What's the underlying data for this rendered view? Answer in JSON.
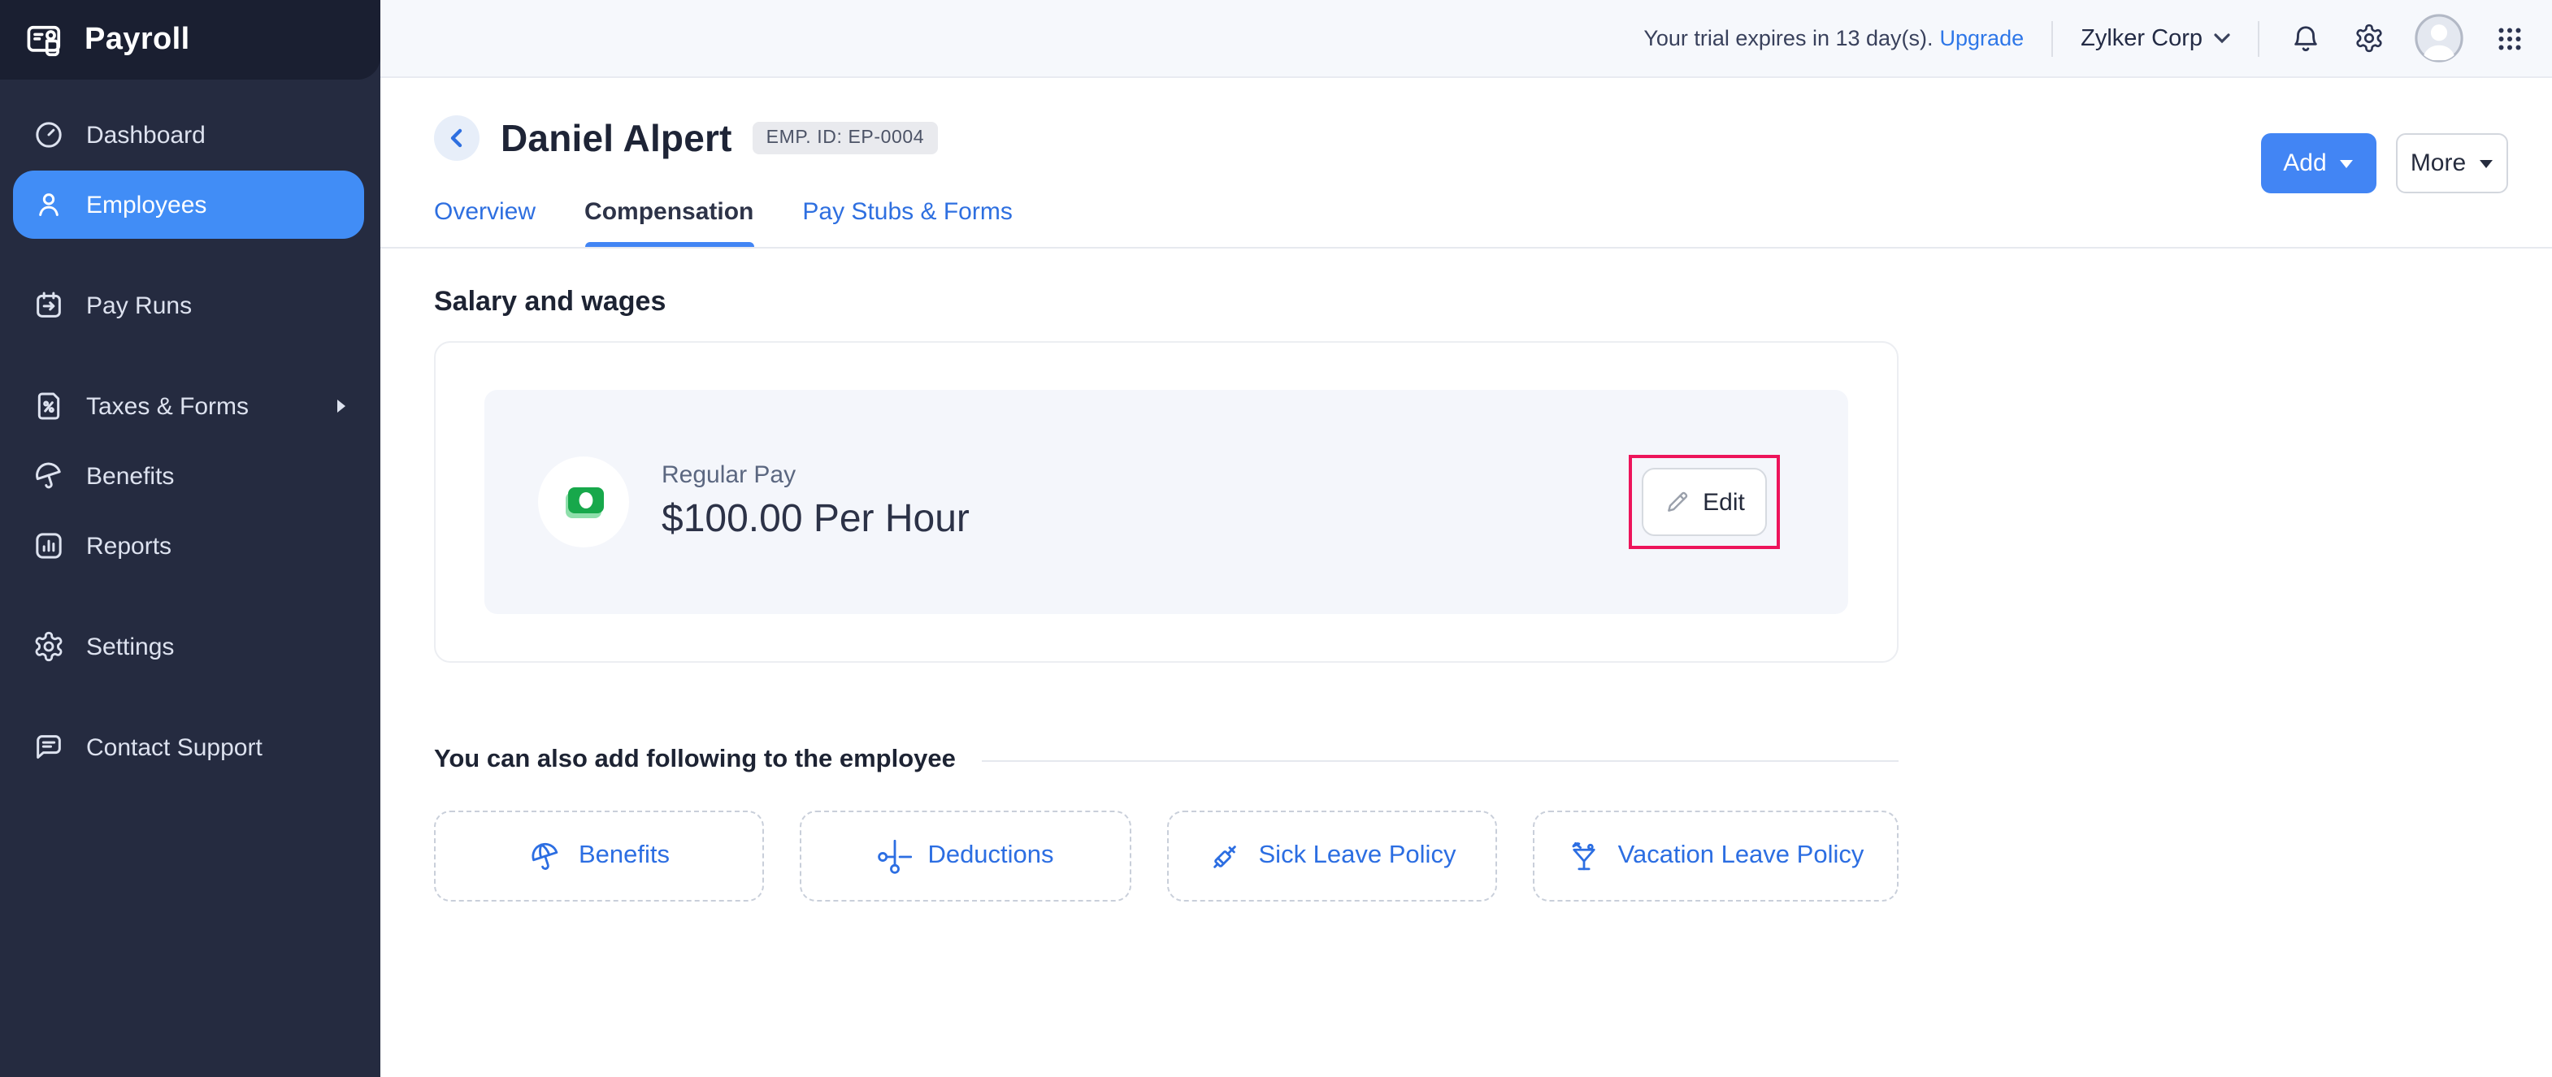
{
  "app": {
    "title": "Payroll"
  },
  "topbar": {
    "trial_text": "Your trial expires in 13 day(s).",
    "upgrade_label": "Upgrade",
    "org_name": "Zylker Corp"
  },
  "sidebar": {
    "items": [
      {
        "label": "Dashboard",
        "icon": "dashboard-icon",
        "active": false
      },
      {
        "label": "Employees",
        "icon": "employees-icon",
        "active": true
      },
      {
        "label": "Pay Runs",
        "icon": "pay-runs-icon",
        "active": false
      },
      {
        "label": "Taxes & Forms",
        "icon": "taxes-forms-icon",
        "active": false,
        "has_submenu": true
      },
      {
        "label": "Benefits",
        "icon": "benefits-icon",
        "active": false
      },
      {
        "label": "Reports",
        "icon": "reports-icon",
        "active": false
      },
      {
        "label": "Settings",
        "icon": "settings-icon",
        "active": false
      },
      {
        "label": "Contact Support",
        "icon": "contact-support-icon",
        "active": false
      }
    ]
  },
  "header": {
    "employee_name": "Daniel Alpert",
    "employee_id_badge": "EMP. ID: EP-0004",
    "tabs": [
      {
        "label": "Overview",
        "active": false
      },
      {
        "label": "Compensation",
        "active": true
      },
      {
        "label": "Pay Stubs & Forms",
        "active": false
      }
    ],
    "add_button": "Add",
    "more_button": "More"
  },
  "salary": {
    "section_title": "Salary and wages",
    "pay_name": "Regular Pay",
    "pay_rate": "$100.00 Per Hour",
    "edit_button": "Edit"
  },
  "add_more": {
    "section_title": "You can also add following to the employee",
    "options": [
      {
        "label": "Benefits",
        "icon": "umbrella-icon"
      },
      {
        "label": "Deductions",
        "icon": "scissors-icon"
      },
      {
        "label": "Sick Leave Policy",
        "icon": "syringe-icon"
      },
      {
        "label": "Vacation Leave Policy",
        "icon": "cocktail-icon"
      }
    ]
  },
  "colors": {
    "accent_blue": "#4285f4",
    "link_blue": "#2e6fe0",
    "annotation_pink": "#ed145b",
    "money_green": "#17a84b",
    "sidebar_bg": "#252b40"
  }
}
